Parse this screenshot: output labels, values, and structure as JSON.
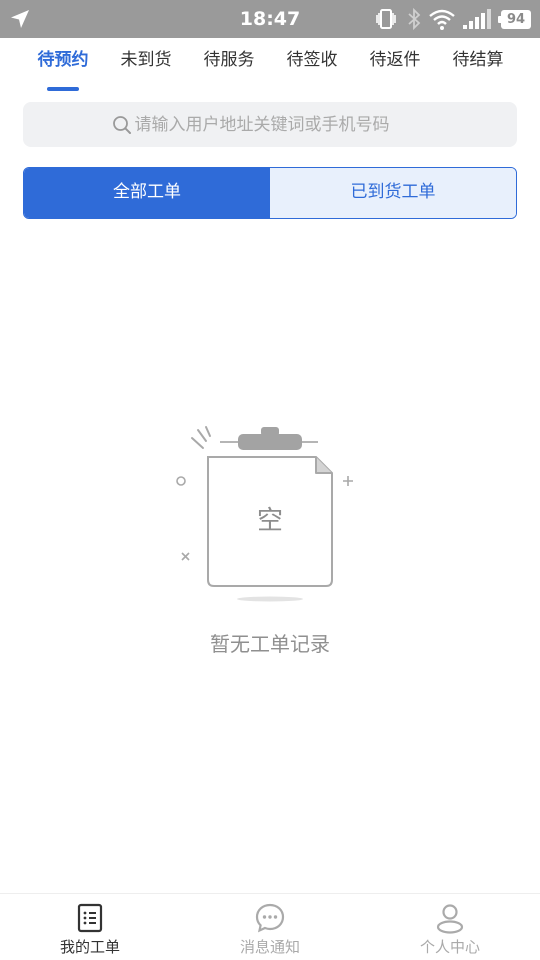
{
  "status_bar": {
    "time": "18:47",
    "battery": "94",
    "icons": [
      "navigation-arrow-icon",
      "vibrate-icon",
      "bluetooth-icon",
      "wifi-icon",
      "signal-icon",
      "battery-icon"
    ]
  },
  "tabs": [
    {
      "label": "待预约",
      "active": true
    },
    {
      "label": "未到货",
      "active": false
    },
    {
      "label": "待服务",
      "active": false
    },
    {
      "label": "待签收",
      "active": false
    },
    {
      "label": "待返件",
      "active": false
    },
    {
      "label": "待结算",
      "active": false
    }
  ],
  "search": {
    "placeholder": "请输入用户地址关键词或手机号码",
    "icon": "search-icon"
  },
  "segment": {
    "left_label": "全部工单",
    "right_label": "已到货工单",
    "selected": "left"
  },
  "empty_state": {
    "illustration_char": "空",
    "message": "暂无工单记录",
    "icon": "clipboard-icon"
  },
  "bottom_nav": [
    {
      "label": "我的工单",
      "icon": "list-document-icon",
      "active": true
    },
    {
      "label": "消息通知",
      "icon": "chat-bubble-icon",
      "active": false
    },
    {
      "label": "个人中心",
      "icon": "user-icon",
      "active": false
    }
  ],
  "colors": {
    "accent": "#2f6bd8",
    "status_bar_bg": "#9a9a9a",
    "search_bg": "#f0f1f3",
    "segment_off_bg": "#e8f0fc",
    "muted_text": "#8f8f8f"
  }
}
